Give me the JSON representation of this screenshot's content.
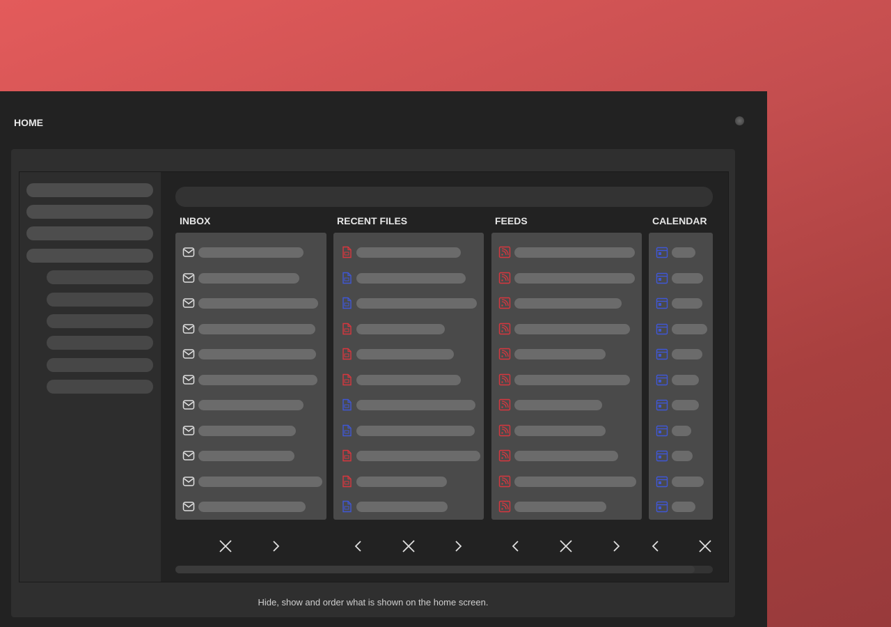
{
  "window": {
    "title": "HOME"
  },
  "footer": {
    "text": "Hide, show and order what is shown on the home screen."
  },
  "columns": [
    {
      "title": "INBOX",
      "icon": "mail-icon"
    },
    {
      "title": "RECENT FILES",
      "icon": "file-icon"
    },
    {
      "title": "FEEDS",
      "icon": "rss-icon"
    },
    {
      "title": "CALENDAR",
      "icon": "calendar-icon"
    }
  ],
  "colors": {
    "accent_red": "#d9363e",
    "accent_blue": "#3f57d6",
    "icon_gray": "#e0e0e0"
  }
}
